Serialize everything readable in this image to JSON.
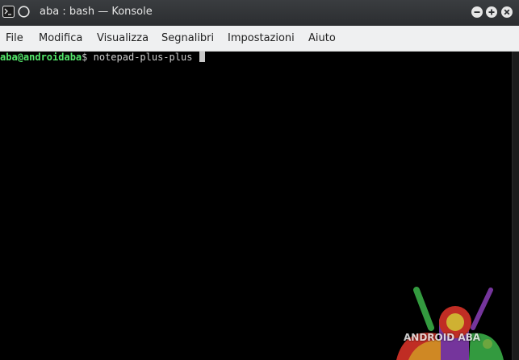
{
  "window": {
    "title": "aba : bash — Konsole"
  },
  "titlebar": {
    "app_icon": "terminal-icon",
    "pin_icon": "circle-pin-icon",
    "minimize_icon": "minimize-icon",
    "maximize_icon": "maximize-icon",
    "close_icon": "close-icon"
  },
  "menubar": {
    "items": [
      {
        "label": "File"
      },
      {
        "label": "Modifica"
      },
      {
        "label": "Visualizza"
      },
      {
        "label": "Segnalibri"
      },
      {
        "label": "Impostazioni"
      },
      {
        "label": "Aiuto"
      }
    ]
  },
  "terminal": {
    "prompt_user": "aba@androidaba",
    "prompt_symbol": "$",
    "command": " notepad-plus-plus"
  },
  "watermark": {
    "text": "ANDROID ABA"
  },
  "colors": {
    "terminal_bg": "#000000",
    "prompt_user": "#54e86b",
    "menubar_bg": "#eff0f1",
    "titlebar_bg": "#2b2d30"
  }
}
